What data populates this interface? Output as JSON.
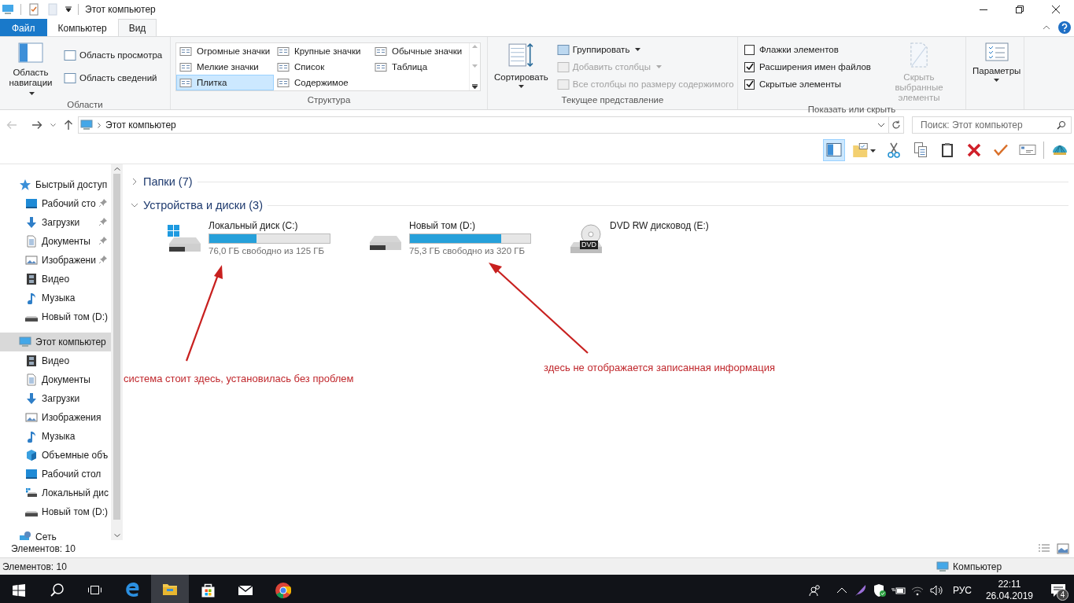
{
  "window": {
    "title": "Этот компьютер"
  },
  "ribbon_tabs": [
    {
      "label": "Файл",
      "kind": "file",
      "selected": false
    },
    {
      "label": "Компьютер",
      "kind": "tab",
      "selected": false
    },
    {
      "label": "Вид",
      "kind": "tab",
      "selected": true
    }
  ],
  "panes_group": {
    "title": "Области",
    "nav_pane": "Область навигации",
    "items": [
      "Область просмотра",
      "Область сведений"
    ]
  },
  "layout_group": {
    "title": "Структура",
    "options": [
      {
        "label": "Огромные значки",
        "selected": false
      },
      {
        "label": "Крупные значки",
        "selected": false
      },
      {
        "label": "Обычные значки",
        "selected": false
      },
      {
        "label": "Мелкие значки",
        "selected": false
      },
      {
        "label": "Список",
        "selected": false
      },
      {
        "label": "Таблица",
        "selected": false
      },
      {
        "label": "Плитка",
        "selected": true
      },
      {
        "label": "Содержимое",
        "selected": false
      }
    ]
  },
  "current_view_group": {
    "title": "Текущее представление",
    "sort": "Сортировать",
    "items": [
      {
        "label": "Группировать",
        "disabled": false
      },
      {
        "label": "Добавить столбцы",
        "disabled": true
      },
      {
        "label": "Все столбцы по размеру содержимого",
        "disabled": true
      }
    ]
  },
  "show_hide_group": {
    "title": "Показать или скрыть",
    "checkboxes": [
      {
        "label": "Флажки элементов",
        "checked": false
      },
      {
        "label": "Расширения имен файлов",
        "checked": true
      },
      {
        "label": "Скрытые элементы",
        "checked": true
      }
    ],
    "hide_selected": {
      "label": "Скрыть выбранные элементы",
      "disabled": true
    }
  },
  "options_group": {
    "label": "Параметры"
  },
  "address_bar": {
    "path": "Этот компьютер"
  },
  "search": {
    "placeholder": "Поиск: Этот компьютер"
  },
  "sidebar": {
    "items": [
      {
        "label": "Быстрый доступ",
        "kind": "star",
        "selected": false,
        "children": [
          {
            "label": "Рабочий сто",
            "kind": "desktop",
            "selected": false,
            "pinned": true
          },
          {
            "label": "Загрузки",
            "kind": "download",
            "selected": false,
            "pinned": true
          },
          {
            "label": "Документы",
            "kind": "docs",
            "selected": false,
            "pinned": true
          },
          {
            "label": "Изображени",
            "kind": "pictures",
            "selected": false,
            "pinned": true
          },
          {
            "label": "Видео",
            "kind": "video",
            "selected": false,
            "pinned": false
          },
          {
            "label": "Музыка",
            "kind": "music",
            "selected": false,
            "pinned": false
          },
          {
            "label": "Новый том (D:)",
            "kind": "drive",
            "selected": false,
            "pinned": false
          }
        ]
      },
      {
        "label": "Этот компьютер",
        "kind": "pc",
        "selected": true,
        "children": [
          {
            "label": "Видео",
            "kind": "video",
            "selected": false
          },
          {
            "label": "Документы",
            "kind": "docs",
            "selected": false
          },
          {
            "label": "Загрузки",
            "kind": "download",
            "selected": false
          },
          {
            "label": "Изображения",
            "kind": "pictures",
            "selected": false
          },
          {
            "label": "Музыка",
            "kind": "music",
            "selected": false
          },
          {
            "label": "Объемные объ",
            "kind": "cube",
            "selected": false
          },
          {
            "label": "Рабочий стол",
            "kind": "desktop",
            "selected": false
          },
          {
            "label": "Локальный дис",
            "kind": "sysdrive",
            "selected": false
          },
          {
            "label": "Новый том (D:)",
            "kind": "drive",
            "selected": false
          }
        ]
      },
      {
        "label": "Сеть",
        "kind": "network",
        "selected": false
      }
    ]
  },
  "sections": [
    {
      "title": "Папки (7)",
      "expanded": false
    },
    {
      "title": "Устройства и диски (3)",
      "expanded": true
    }
  ],
  "drives": [
    {
      "name": "Локальный диск (C:)",
      "kind": "system",
      "level": 0.39,
      "free": "76,0 ГБ свободно из 125 ГБ"
    },
    {
      "name": "Новый том (D:)",
      "kind": "hdd",
      "level": 0.76,
      "free": "75,3 ГБ свободно из 320 ГБ"
    },
    {
      "name": "DVD RW дисковод (E:)",
      "kind": "dvd",
      "badge": "DVD"
    }
  ],
  "annotations": [
    {
      "text": "система стоит здесь, установилась без проблем"
    },
    {
      "text": "здесь не отображается записанная информация"
    }
  ],
  "pane_status": "Элементов: 10",
  "status_bar": {
    "count": "Элементов: 10",
    "location": "Компьютер"
  },
  "taskbar": {
    "language": "РУС",
    "time": "22:11",
    "date": "26.04.2019",
    "notifications": "4"
  }
}
